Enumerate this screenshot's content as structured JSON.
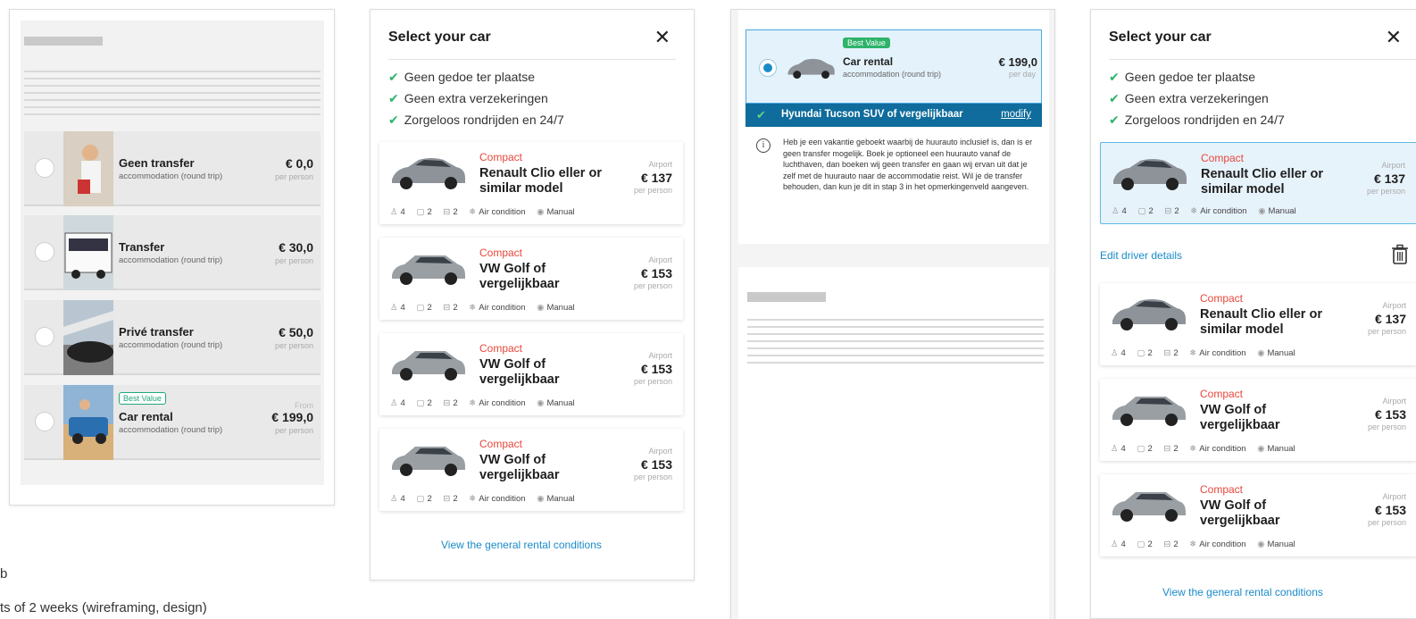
{
  "side_text": {
    "line1": "b",
    "line2": "ts of 2 weeks (wireframing, design)"
  },
  "transfer_panel": {
    "options": [
      {
        "name": "Geen transfer",
        "sub": "accommodation (round trip)",
        "price": "€ 0,0",
        "per": "per person"
      },
      {
        "name": "Transfer",
        "sub": "accommodation (round trip)",
        "price": "€ 30,0",
        "per": "per person"
      },
      {
        "name": "Privé transfer",
        "sub": "accommodation (round trip)",
        "price": "€ 50,0",
        "per": "per person"
      },
      {
        "name": "Car rental",
        "sub": "accommodation (round trip)",
        "price": "€ 199,0",
        "per": "per person",
        "from": "From",
        "badge": "Best Value"
      }
    ]
  },
  "car_panel": {
    "title": "Select your car",
    "close": "✕",
    "checks": [
      "Geen gedoe ter plaatse",
      "Geen extra verzekeringen",
      "Zorgeloos rondrijden en 24/7"
    ],
    "cars": [
      {
        "category": "Compact",
        "model": "Renault Clio eller or similar model",
        "location": "Airport",
        "price": "€ 137",
        "per": "per person"
      },
      {
        "category": "Compact",
        "model": "VW Golf of vergelijkbaar",
        "location": "Airport",
        "price": "€ 153",
        "per": "per person"
      },
      {
        "category": "Compact",
        "model": "VW Golf of vergelijkbaar",
        "location": "Airport",
        "price": "€ 153",
        "per": "per person"
      },
      {
        "category": "Compact",
        "model": "VW Golf of vergelijkbaar",
        "location": "Airport",
        "price": "€ 153",
        "per": "per person"
      }
    ],
    "specs": {
      "seats": "4",
      "bags": "2",
      "doors": "2",
      "aircon": "Air condition",
      "gear": "Manual"
    },
    "footer_link": "View the general rental conditions"
  },
  "summary_panel": {
    "badge": "Best Value",
    "name": "Car rental",
    "sub": "accommodation (round trip)",
    "price": "€ 199,0",
    "per": "per day",
    "selected_car": "Hyundai Tucson SUV of vergelijkbaar",
    "modify": "modify",
    "info_icon": "i",
    "info": "Heb je een vakantie geboekt waarbij de huurauto inclusief is, dan is er geen transfer mogelijk. Boek je optioneel een huurauto vanaf de luchthaven, dan boeken wij geen transfer en gaan wij ervan uit dat je zelf met de huurauto naar de accommodatie reist. Wil je de transfer behouden, dan kun je dit in stap 3 in het opmerkingenveld aangeven."
  },
  "car_panel_2": {
    "title": "Select your car",
    "close": "✕",
    "edit_driver": "Edit driver details",
    "footer_link": "View the general rental conditions"
  }
}
